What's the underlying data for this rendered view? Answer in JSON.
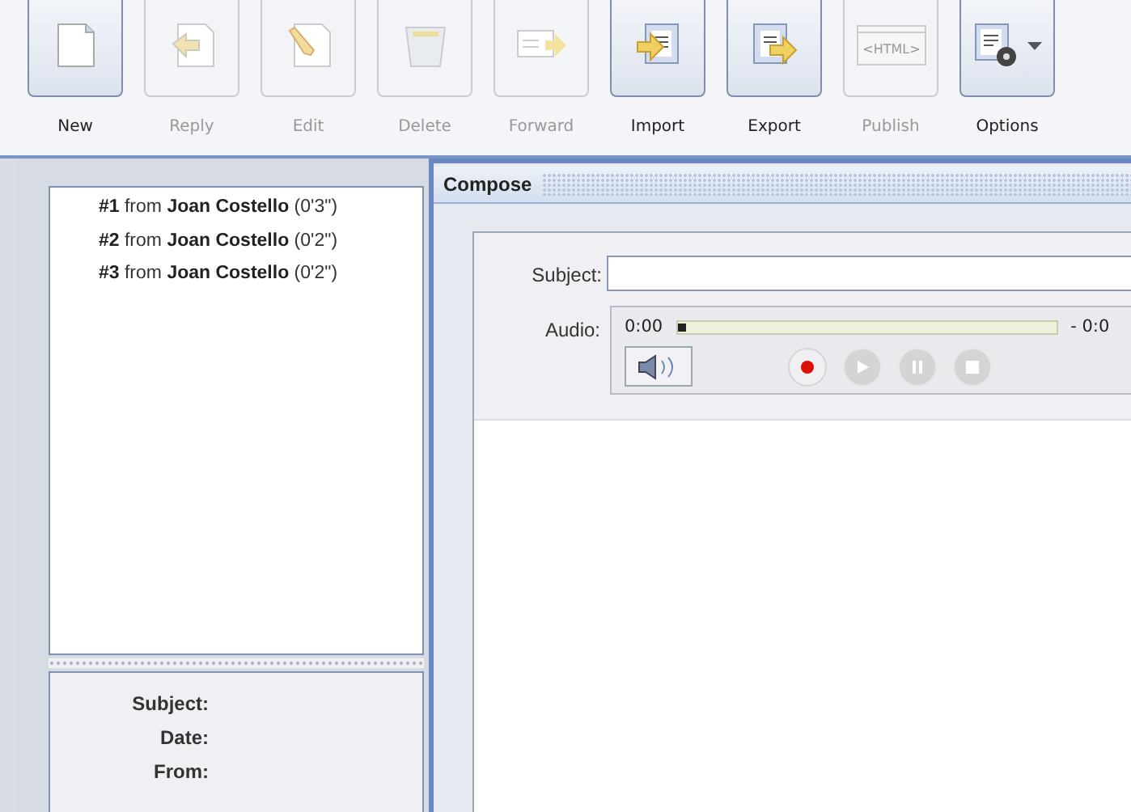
{
  "toolbar": [
    {
      "label": "New",
      "disabled": false
    },
    {
      "label": "Reply",
      "disabled": true
    },
    {
      "label": "Edit",
      "disabled": true
    },
    {
      "label": "Delete",
      "disabled": true
    },
    {
      "label": "Forward",
      "disabled": true
    },
    {
      "label": "Import",
      "disabled": false
    },
    {
      "label": "Export",
      "disabled": false
    },
    {
      "label": "Publish",
      "disabled": true,
      "icon_text": "<HTML>"
    },
    {
      "label": "Options",
      "disabled": false,
      "dropdown": true
    }
  ],
  "messages": [
    {
      "text": "**#1** from **Joan Costello** (0'3\")",
      "selected": false
    },
    {
      "text": "**#2** from **Joan Costello** (0'2\")",
      "selected": false
    },
    {
      "text": "**#3** from **Joan Costello** (0'2\")",
      "selected": false
    }
  ],
  "details": {
    "labels": [
      "Subject:",
      "Date:",
      "From:"
    ]
  },
  "compose": {
    "title": "Compose",
    "subject_label": "Subject:",
    "audio_label": "Audio:",
    "elapsed": "0:00",
    "remaining": "- 0:0",
    "level": 0.0,
    "controls": [
      {
        "kind": "record",
        "disabled": false
      },
      {
        "kind": "play",
        "disabled": true
      },
      {
        "kind": "pause",
        "disabled": true
      },
      {
        "kind": "stop",
        "disabled": true
      }
    ]
  }
}
